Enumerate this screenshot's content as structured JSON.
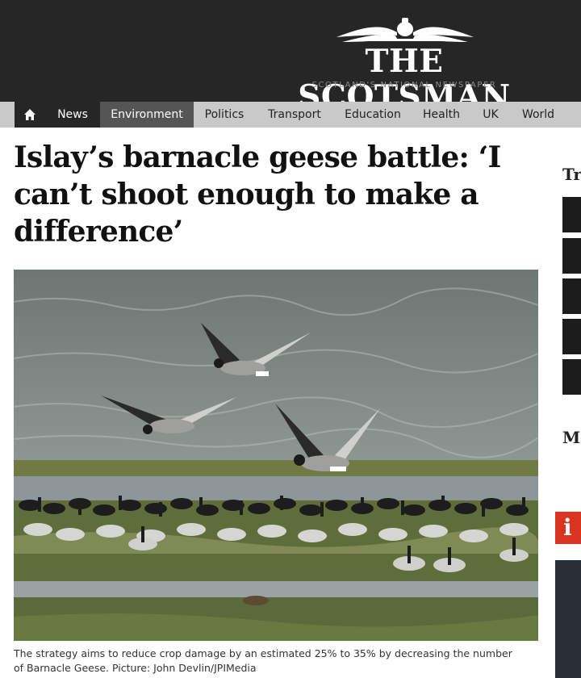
{
  "brand": {
    "name": "THE SCOTSMAN",
    "tagline": "SCOTLAND'S NATIONAL NEWSPAPER"
  },
  "nav": {
    "home_icon": "home-icon",
    "items": [
      "News",
      "Environment",
      "Politics",
      "Transport",
      "Education",
      "Health",
      "UK",
      "World"
    ]
  },
  "article": {
    "headline_lines": [
      "Islay’s barnacle geese battle: ‘I",
      "can’t shoot enough to make a",
      "difference’"
    ],
    "caption_lines": [
      "The strategy aims to reduce crop damage by an estimated 25% to 35% by decreasing the number",
      "of Barnacle Geese. Picture: John Devlin/JPIMedia"
    ]
  },
  "rail": {
    "heading_trending": "Tr",
    "heading_more": "Mo",
    "badge": "i"
  },
  "colors": {
    "masthead": "#262626",
    "nav_bg": "#c9c9c9",
    "nav_active": "#555555",
    "badge": "#d9341f"
  }
}
